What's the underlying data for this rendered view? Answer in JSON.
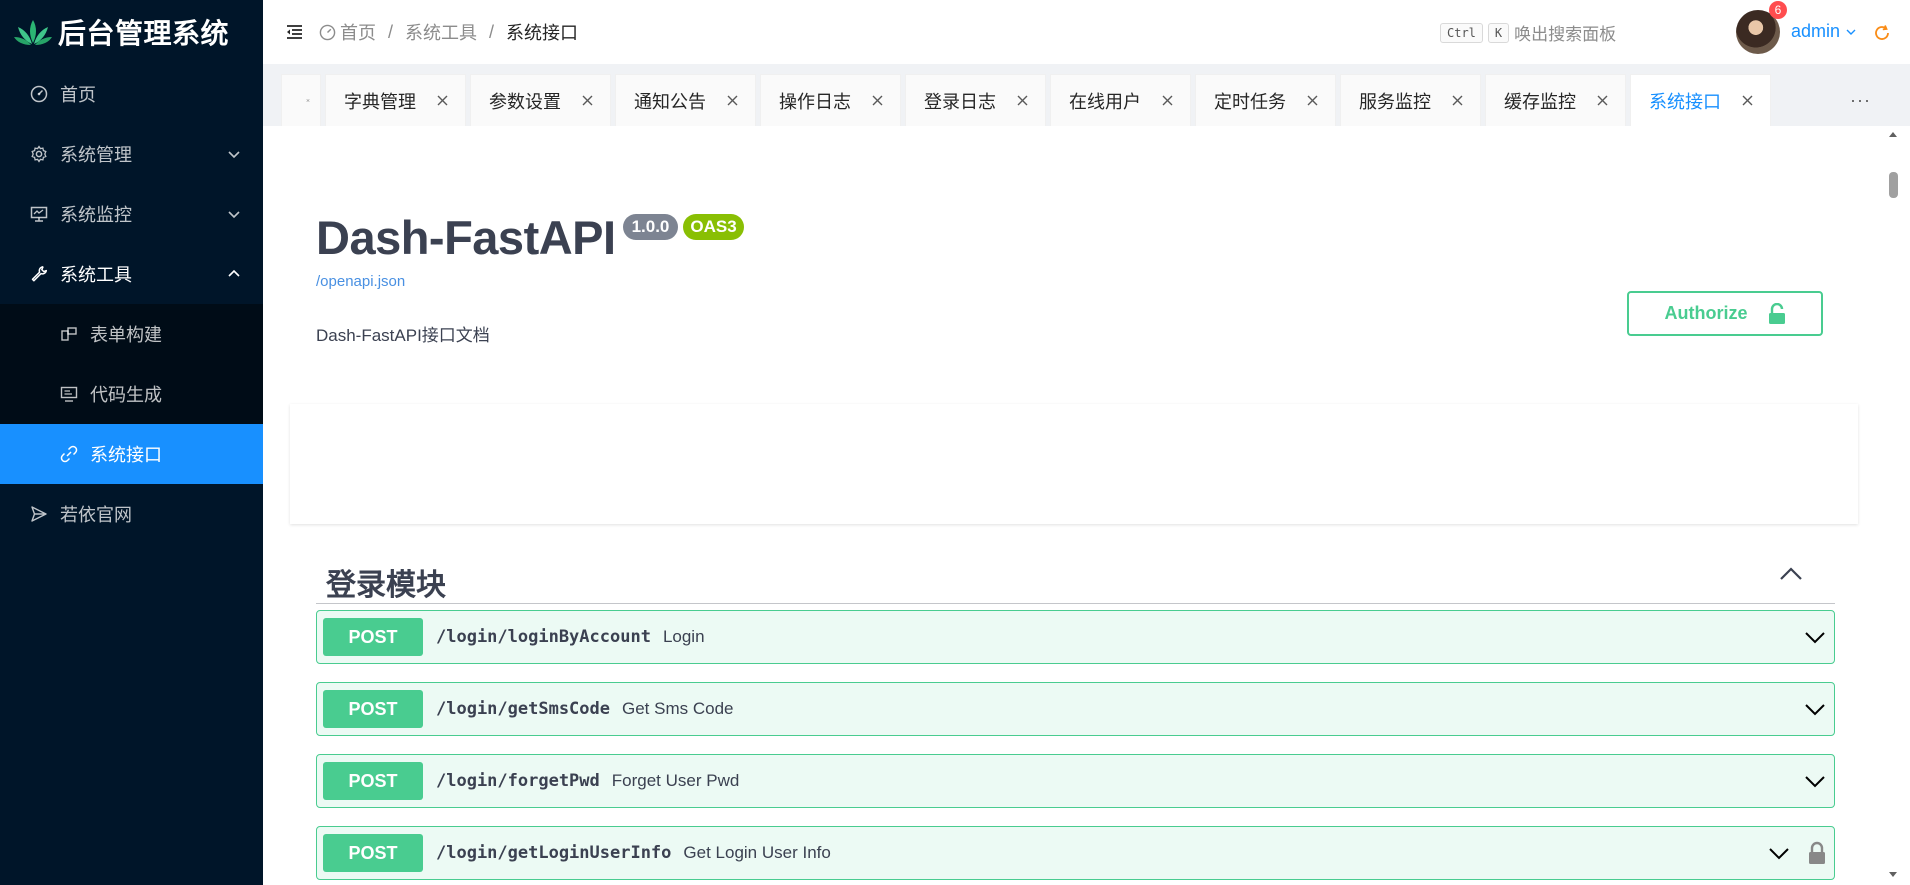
{
  "app": {
    "title": "后台管理系统"
  },
  "sidebar": {
    "items": [
      {
        "label": "首页",
        "icon": "dashboard-icon"
      },
      {
        "label": "系统管理",
        "icon": "gear-icon",
        "arrow": "chevron-down-icon"
      },
      {
        "label": "系统监控",
        "icon": "monitor-icon",
        "arrow": "chevron-down-icon"
      },
      {
        "label": "系统工具",
        "icon": "tool-icon",
        "arrow": "chevron-up-icon"
      },
      {
        "label": "若依官网",
        "icon": "send-icon"
      }
    ],
    "submenu": [
      {
        "label": "表单构建",
        "icon": "build-icon"
      },
      {
        "label": "代码生成",
        "icon": "code-icon"
      },
      {
        "label": "系统接口",
        "icon": "api-icon"
      }
    ],
    "colors": {
      "bg": "#001529",
      "selected": "#1890ff"
    }
  },
  "header": {
    "breadcrumb": [
      "首页",
      "系统工具",
      "系统接口"
    ],
    "search_keys": [
      "Ctrl",
      "K"
    ],
    "search_hint": "唤出搜索面板",
    "badge_count": "6",
    "user_name": "admin"
  },
  "tabs": [
    {
      "label": "字典管理"
    },
    {
      "label": "参数设置"
    },
    {
      "label": "通知公告"
    },
    {
      "label": "操作日志"
    },
    {
      "label": "登录日志"
    },
    {
      "label": "在线用户"
    },
    {
      "label": "定时任务"
    },
    {
      "label": "服务监控"
    },
    {
      "label": "缓存监控"
    },
    {
      "label": "系统接口",
      "active": true
    }
  ],
  "tabs_more": "···",
  "swagger": {
    "title": "Dash-FastAPI",
    "version": "1.0.0",
    "oas": "OAS3",
    "spec_link": "/openapi.json",
    "description": "Dash-FastAPI接口文档",
    "authorize_label": "Authorize",
    "section_title": "登录模块",
    "operations": [
      {
        "method": "POST",
        "path": "/login/loginByAccount",
        "summary": "Login",
        "locked": false
      },
      {
        "method": "POST",
        "path": "/login/getSmsCode",
        "summary": "Get Sms Code",
        "locked": false
      },
      {
        "method": "POST",
        "path": "/login/forgetPwd",
        "summary": "Forget User Pwd",
        "locked": false
      },
      {
        "method": "POST",
        "path": "/login/getLoginUserInfo",
        "summary": "Get Login User Info",
        "locked": true
      }
    ],
    "colors": {
      "post": "#49cc90",
      "version_badge": "#7d8492",
      "oas_badge": "#89bf04",
      "link": "#4990e2"
    }
  }
}
